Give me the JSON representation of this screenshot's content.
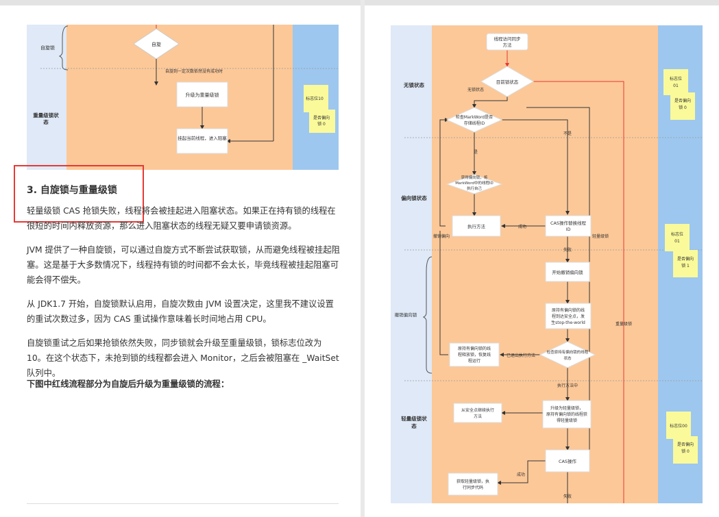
{
  "left_page": {
    "figure": {
      "lane_spin": "自旋锁",
      "diamond_spin": "自旋",
      "failed_note": "自旋到一定次数依然没有成功时",
      "box_upgrade": "升级为重量级锁",
      "box_suspend": "挂起当前线程，进入阻塞",
      "lane_heavy_line1": "重量级锁状",
      "lane_heavy_line2": "态",
      "sticky_line1": "标志位10",
      "sticky_line2": "是否偏向",
      "sticky_line3": "锁 0"
    },
    "heading": "3. 自旋锁与重量级锁",
    "paragraphs": [
      "轻量级锁 CAS 抢锁失败，线程将会被挂起进入阻塞状态。如果正在持有锁的线程在很短的时间内释放资源，那么进入阻塞状态的线程无疑又要申请锁资源。",
      "JVM 提供了一种自旋锁，可以通过自旋方式不断尝试获取锁，从而避免线程被挂起阻塞。这是基于大多数情况下，线程持有锁的时间都不会太长，毕竟线程被挂起阻塞可能会得不偿失。",
      "从 JDK1.7 开始，自旋锁默认启用，自旋次数由 JVM 设置决定，这里我不建议设置的重试次数过多，因为 CAS 重试操作意味着长时间地占用 CPU。",
      "自旋锁重试之后如果抢锁依然失败，同步锁就会升级至重量级锁，锁标志位改为 10。在这个状态下，未抢到锁的线程都会进入 Monitor，之后会被阻塞在 _WaitSet 队列中。"
    ],
    "bold_line": "下图中红线流程部分为自旋后升级为重量级锁的流程："
  },
  "right_page": {
    "figure": {
      "lanes": {
        "no_lock": "无锁状态",
        "biased": "偏向锁状态",
        "revoke": "撤销偏向锁",
        "light1": "轻量级锁状",
        "light2": "态"
      },
      "nodes": {
        "start1": "线程访问同步",
        "start2": "方法",
        "d1": "目前锁状态",
        "d2a": "检查MarkWord是否",
        "d2b": "存储线程ID",
        "b1a": "获得偏向锁，将",
        "b1b": "MarkWord中的线程ID",
        "b1c": "执行自己",
        "exec": "执行方法",
        "cas1a": "CAS操作替换线程",
        "cas1b": "ID",
        "revoke_start": "开始撤销偏向锁",
        "stop1": "原持有偏向锁的线",
        "stop2": "程到达安全点，发",
        "stop3": "生stop-the-world",
        "d3a": "检查原持有偏向锁的线程",
        "d3b": "状态",
        "release1": "原持有偏向锁的线",
        "release2": "程释放锁，恢复线",
        "release3": "程运行",
        "upg1": "升级为轻量级锁，",
        "upg2": "原持有偏向锁的线程获",
        "upg3": "得轻量级锁",
        "safe1": "从安全点继续执行",
        "safe2": "方法",
        "cas2": "CAS操作",
        "getlight1": "获取轻量级锁，执",
        "getlight2": "行同步代码"
      },
      "edge_labels": {
        "no_lock": "无锁状态",
        "yes": "是",
        "no": "不是",
        "success": "成功",
        "fail": "失败",
        "exited": "已退出执行方法",
        "executing": "执行方法中",
        "revoke_biased": "撤销偏向",
        "light_lock": "轻量级锁",
        "heavy_lock": "重量级锁",
        "success2": "成功",
        "fail2": "失败"
      },
      "stickies": [
        {
          "l1": "标志位",
          "l2": "01",
          "l3": "是否偏向",
          "l4": "锁 0"
        },
        {
          "l1": "标志位",
          "l2": "01",
          "l3": "是否偏向",
          "l4": "锁 1"
        },
        {
          "l1": "标志位00",
          "l2": "",
          "l3": "是否偏向",
          "l4": "锁 0"
        }
      ]
    }
  },
  "colors": {
    "lane_blue": "#dfe9f7",
    "orange": "#fcc898",
    "right_blue": "#9dc7ef",
    "sticky": "#fafa9a",
    "red": "#e53935"
  }
}
